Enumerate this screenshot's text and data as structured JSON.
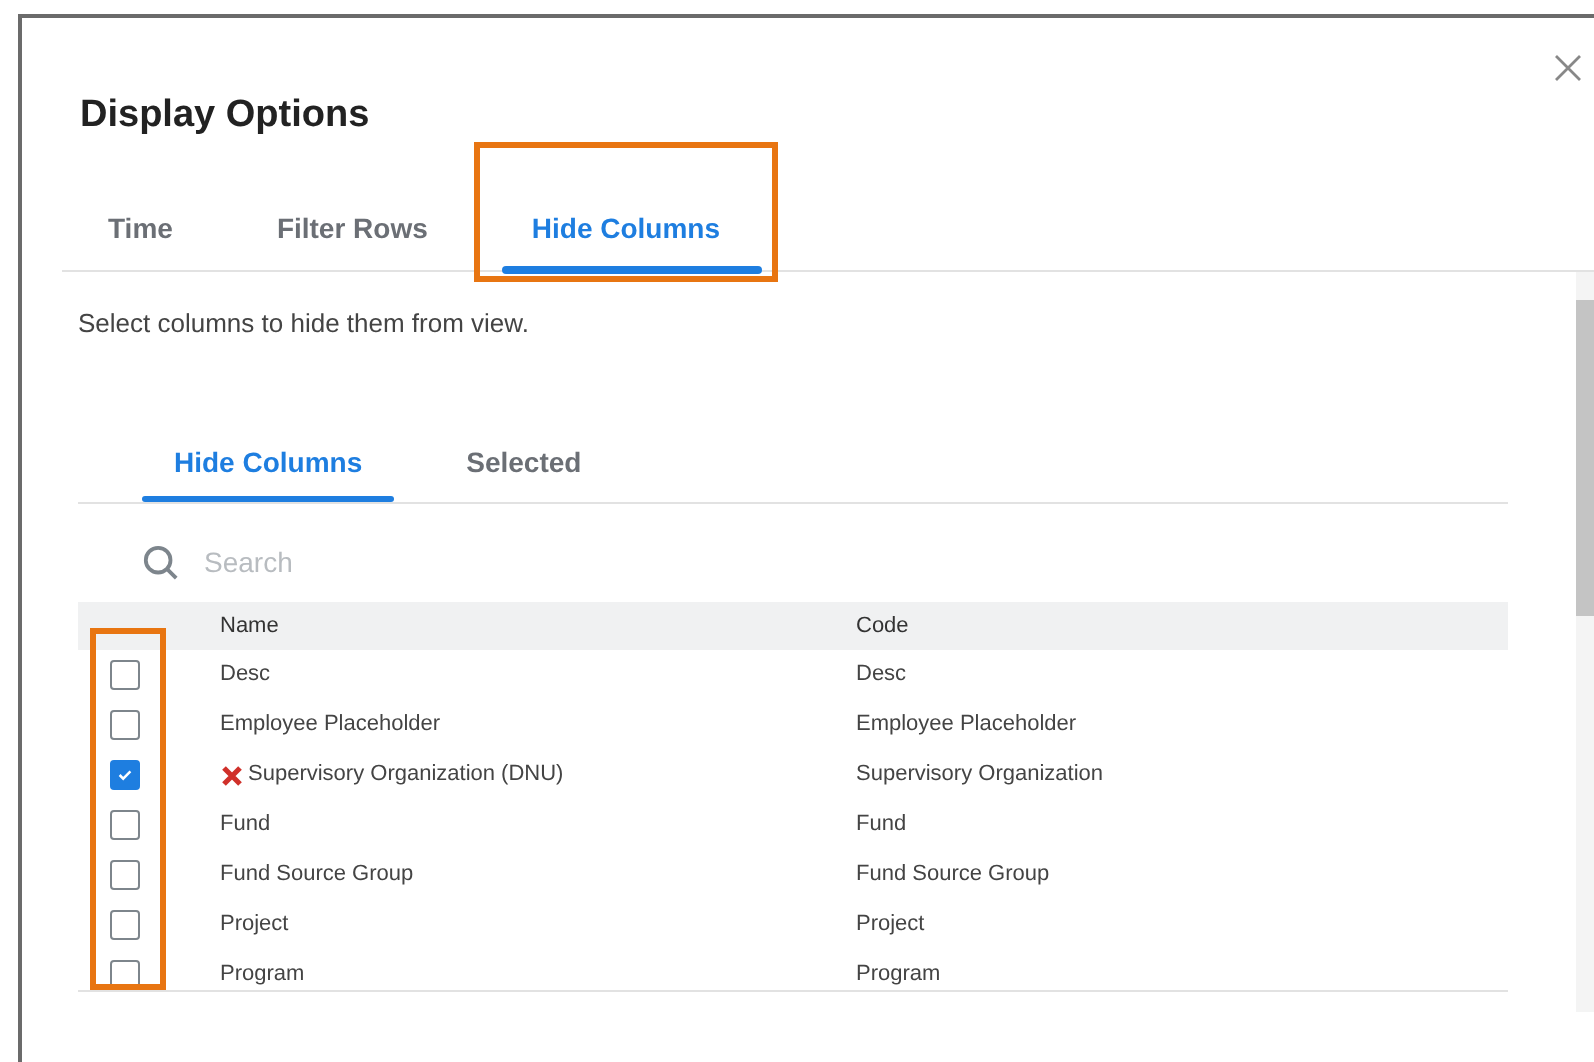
{
  "dialog": {
    "title": "Display Options"
  },
  "tabs": [
    {
      "label": "Time",
      "selected": false
    },
    {
      "label": "Filter Rows",
      "selected": false
    },
    {
      "label": "Hide Columns",
      "selected": true,
      "highlighted": true
    }
  ],
  "instructions": "Select columns to hide them from view.",
  "subtabs": [
    {
      "label": "Hide Columns",
      "selected": true
    },
    {
      "label": "Selected",
      "selected": false
    }
  ],
  "search": {
    "placeholder": "Search"
  },
  "table": {
    "columns": [
      "Name",
      "Code"
    ],
    "rows": [
      {
        "checked": false,
        "flagged": false,
        "name": "Desc",
        "code": "Desc"
      },
      {
        "checked": false,
        "flagged": false,
        "name": "Employee Placeholder",
        "code": "Employee Placeholder"
      },
      {
        "checked": true,
        "flagged": true,
        "name": "Supervisory Organization (DNU)",
        "code": "Supervisory Organization"
      },
      {
        "checked": false,
        "flagged": false,
        "name": "Fund",
        "code": "Fund"
      },
      {
        "checked": false,
        "flagged": false,
        "name": "Fund Source Group",
        "code": "Fund Source Group"
      },
      {
        "checked": false,
        "flagged": false,
        "name": "Project",
        "code": "Project"
      },
      {
        "checked": false,
        "flagged": false,
        "name": "Program",
        "code": "Program"
      }
    ],
    "checkbox_column_highlighted": true
  }
}
